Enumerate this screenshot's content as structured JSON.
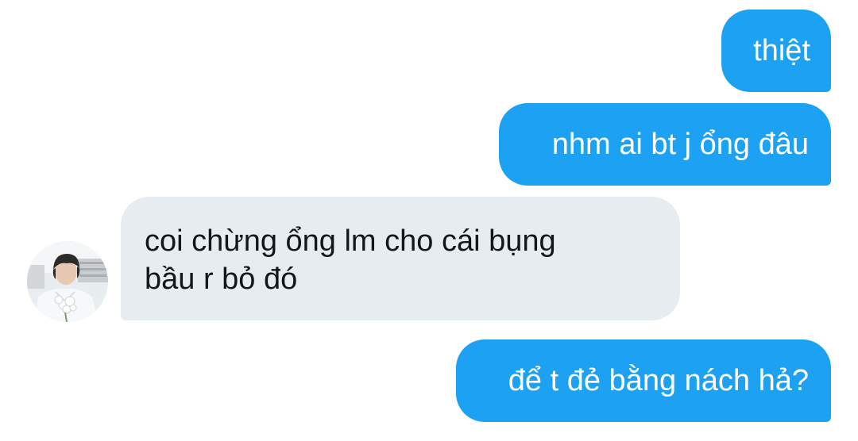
{
  "conversation": {
    "messages": [
      {
        "direction": "sent",
        "text": "thiệt"
      },
      {
        "direction": "sent",
        "text": "nhm ai bt j ổng đâu"
      },
      {
        "direction": "received",
        "text": "coi chừng ổng lm cho cái bụng\nbầu r bỏ đó"
      },
      {
        "direction": "sent",
        "text": "để t đẻ bằng nách hả?"
      }
    ],
    "avatar_icon": "user-avatar-photo"
  },
  "colors": {
    "sent_bubble": "#1da1f2",
    "received_bubble": "#e6ecf0",
    "sent_text": "#ffffff",
    "received_text": "#14171a",
    "background": "#ffffff"
  }
}
